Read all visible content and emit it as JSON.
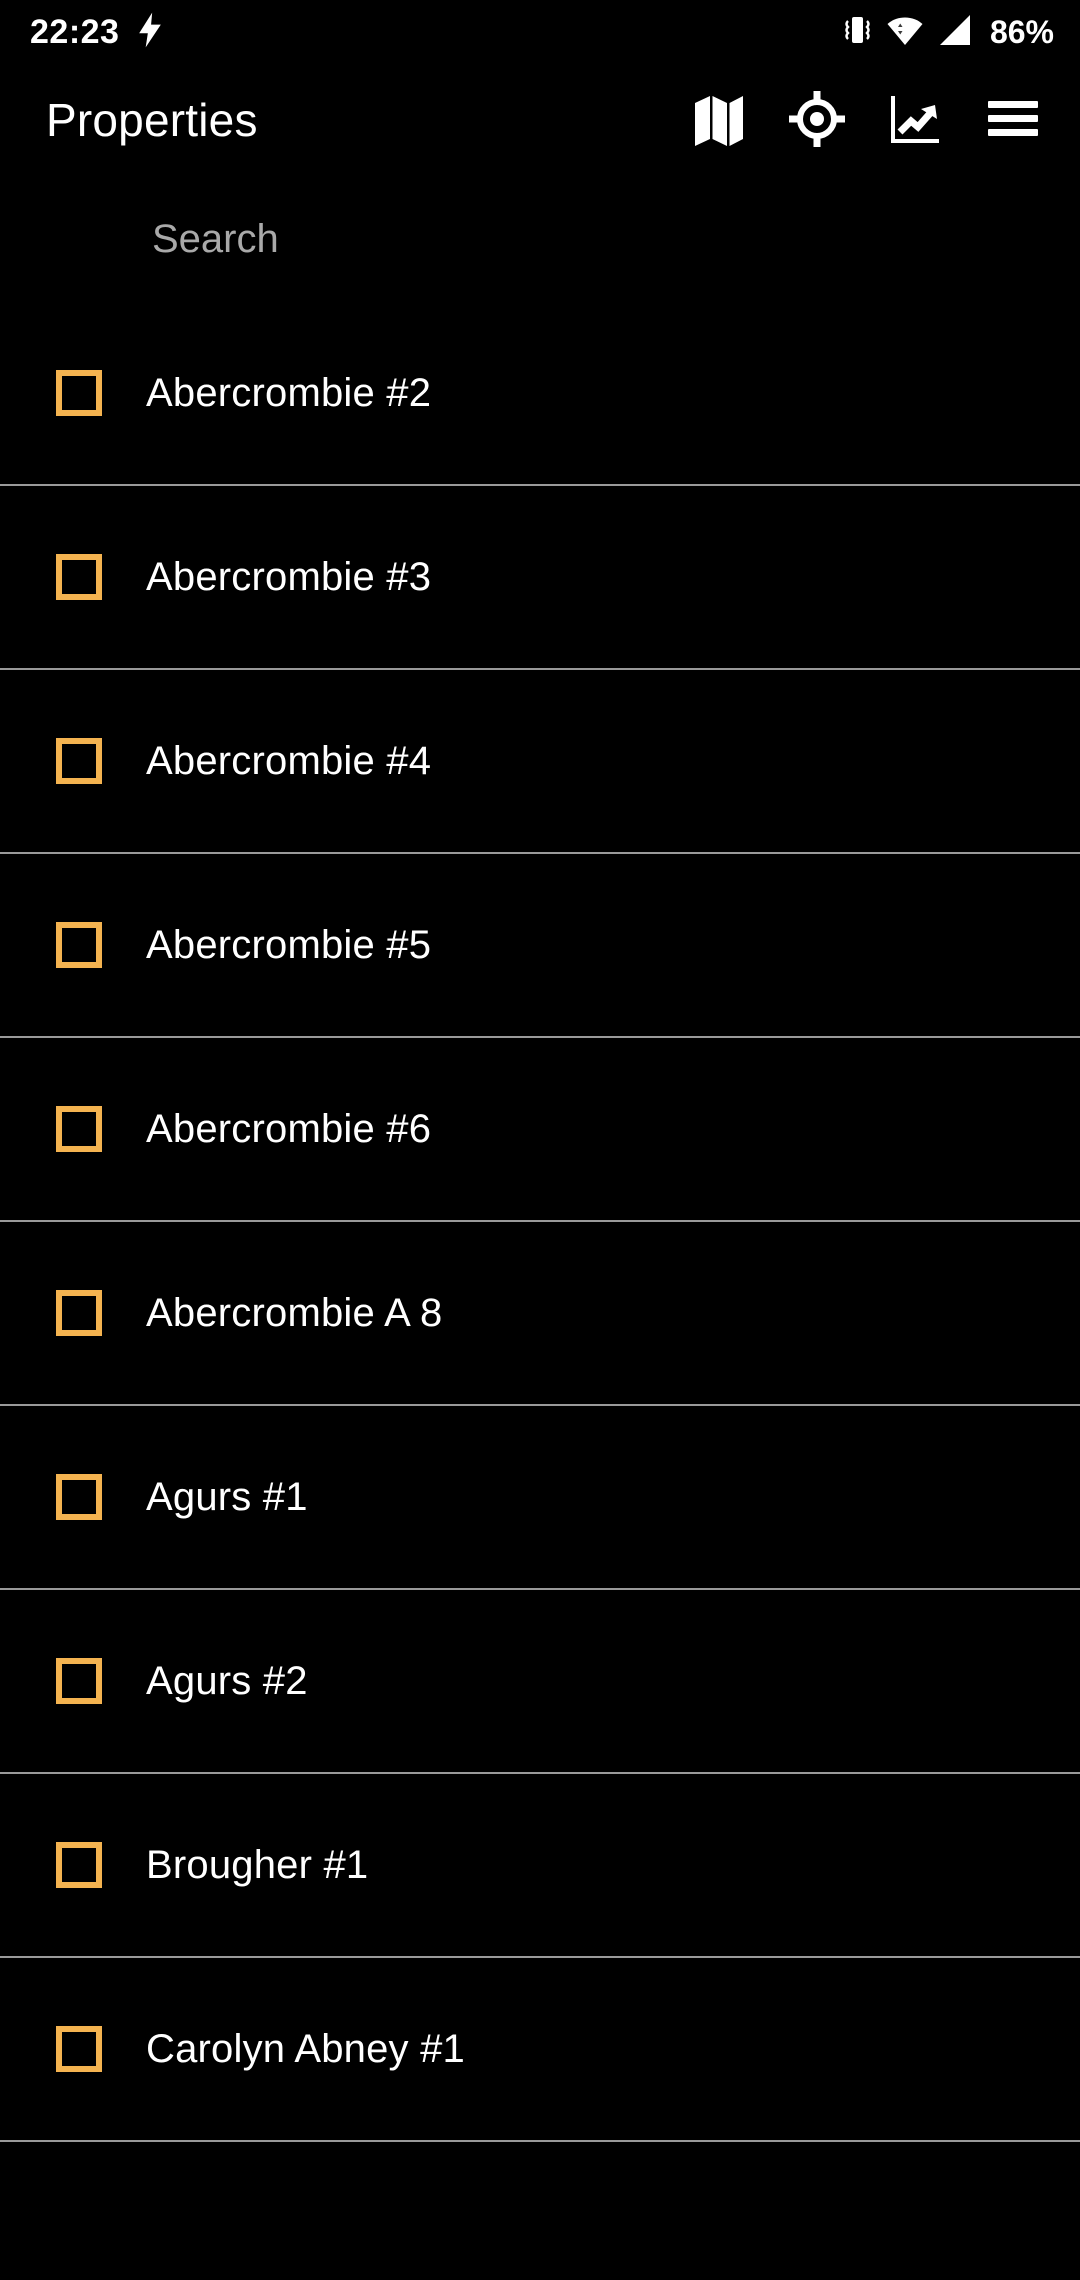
{
  "status_bar": {
    "clock": "22:23",
    "charging_icon": "lightning-bolt-icon",
    "vibrate_icon": "vibrate-icon",
    "wifi_icon": "wifi-icon",
    "cellular_icon": "cellular-signal-icon",
    "battery_percent": "86%"
  },
  "app_bar": {
    "title": "Properties",
    "actions": [
      {
        "name": "map-icon",
        "label": "Map"
      },
      {
        "name": "gps-target-icon",
        "label": "Locate"
      },
      {
        "name": "chart-line-icon",
        "label": "Charts"
      },
      {
        "name": "hamburger-menu-icon",
        "label": "Menu"
      }
    ]
  },
  "search": {
    "placeholder": "Search",
    "value": ""
  },
  "list": {
    "items": [
      {
        "label": "Abercrombie #2",
        "checked": false
      },
      {
        "label": "Abercrombie #3",
        "checked": false
      },
      {
        "label": "Abercrombie #4",
        "checked": false
      },
      {
        "label": "Abercrombie #5",
        "checked": false
      },
      {
        "label": "Abercrombie #6",
        "checked": false
      },
      {
        "label": "Abercrombie A 8",
        "checked": false
      },
      {
        "label": "Agurs #1",
        "checked": false
      },
      {
        "label": "Agurs #2",
        "checked": false
      },
      {
        "label": "Brougher #1",
        "checked": false
      },
      {
        "label": "Carolyn Abney #1",
        "checked": false
      }
    ]
  },
  "colors": {
    "background": "#000000",
    "accent": "#f4b350",
    "text": "#ffffff",
    "placeholder": "#a9a9a9",
    "divider": "#9a9a9a"
  }
}
